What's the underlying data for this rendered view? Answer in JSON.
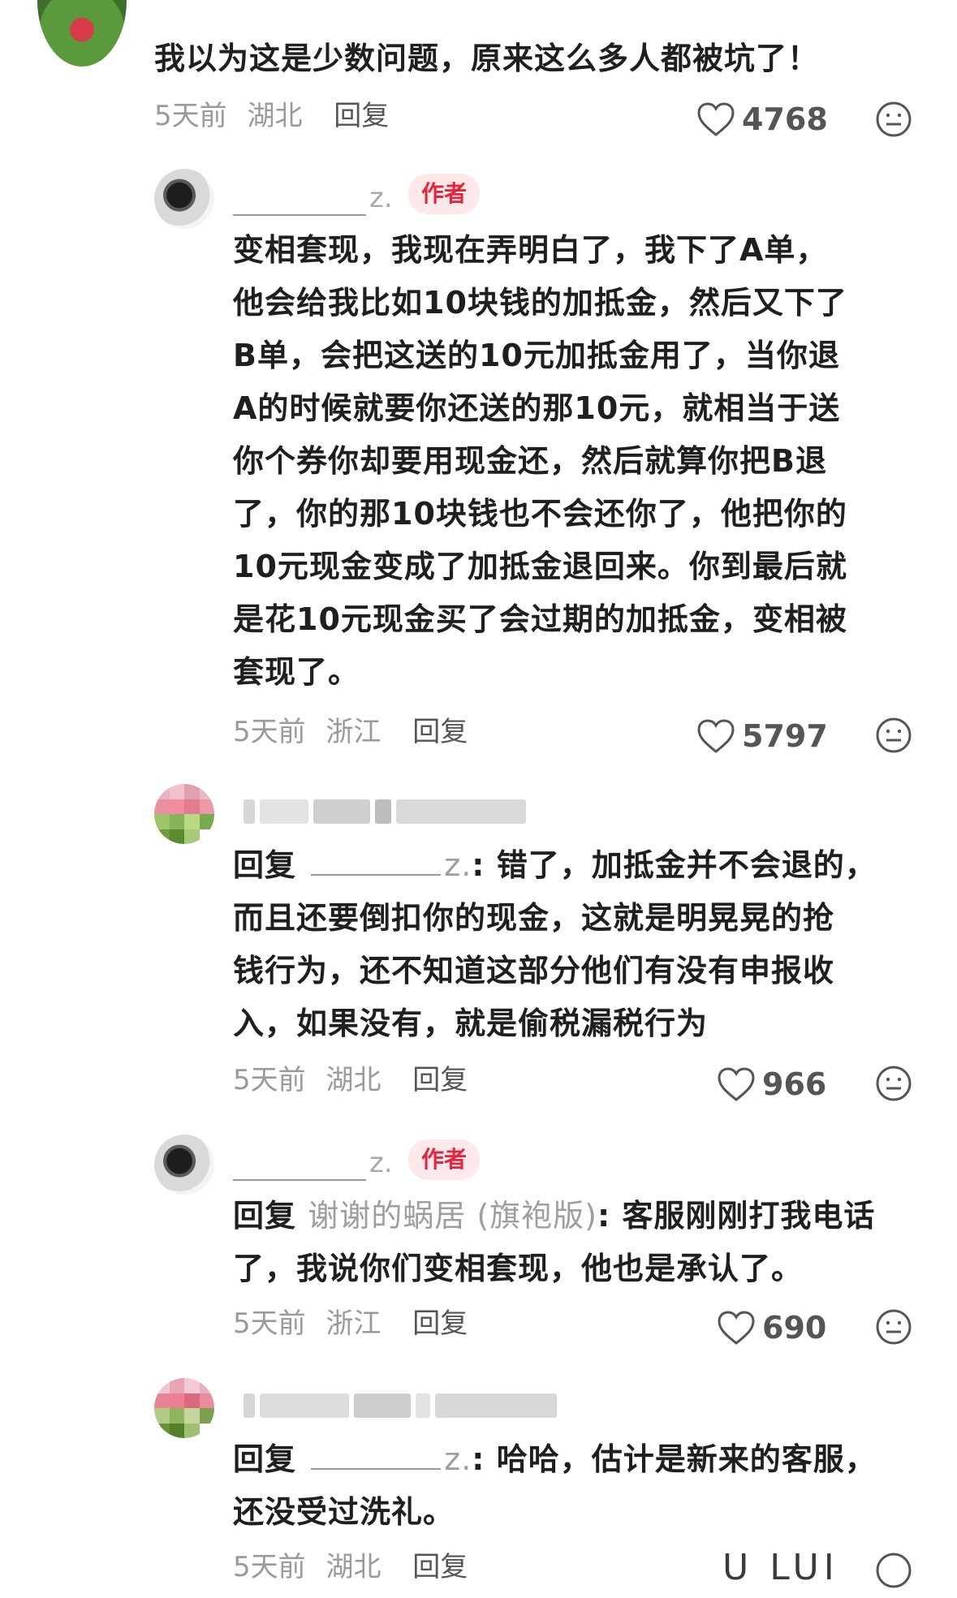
{
  "comments": [
    {
      "text": "我以为这是少数问题，原来这么多人都被坑了！",
      "time": "5天前",
      "location": "湖北",
      "reply": "回复",
      "likes": "4768"
    },
    {
      "name": "z.",
      "badge": "作者",
      "lines": [
        "变相套现，我现在弄明白了，我下了A单，",
        "他会给我比如10块钱的加抵金，然后又下了",
        "B单，会把这送的10元加抵金用了，当你退",
        "A的时候就要你还送的那10元，就相当于送",
        "你个券你却要用现金还，然后就算你把B退",
        "了，你的那10块钱也不会还你了，他把你的",
        "10元现金变成了加抵金退回来。你到最后就",
        "是花10元现金买了会过期的加抵金，变相被",
        "套现了。"
      ],
      "time": "5天前",
      "location": "浙江",
      "reply": "回复",
      "likes": "5797"
    },
    {
      "reply_prefix": "回复",
      "mention": "z.",
      "first_line_rest": ": 错了，加抵金并不会退的，",
      "lines": [
        "而且还要倒扣你的现金，这就是明晃晃的抢",
        "钱行为，还不知道这部分他们有没有申报收",
        "入，如果没有，就是偷税漏税行为"
      ],
      "time": "5天前",
      "location": "湖北",
      "reply": "回复",
      "likes": "966"
    },
    {
      "name": "z.",
      "badge": "作者",
      "reply_prefix": "回复",
      "mention": "谢谢的蜗居 (旗袍版)",
      "first_line_rest": ": 客服刚刚打我电话",
      "lines": [
        "了，我说你们变相套现，他也是承认了。"
      ],
      "time": "5天前",
      "location": "浙江",
      "reply": "回复",
      "likes": "690"
    },
    {
      "reply_prefix": "回复",
      "mention": "z.",
      "first_line_rest": ": 哈哈，估计是新来的客服，",
      "lines": [
        "还没受过洗礼。"
      ],
      "time": "5天前",
      "location": "湖北",
      "reply": "回复",
      "partial_glyphs": "U LUI"
    }
  ],
  "colors": {
    "badge_bg": "#fde8ea",
    "badge_text": "#e5243e",
    "meta": "#9a9a9a"
  },
  "icons": [
    "heart-outline-icon",
    "neutral-face-icon"
  ]
}
